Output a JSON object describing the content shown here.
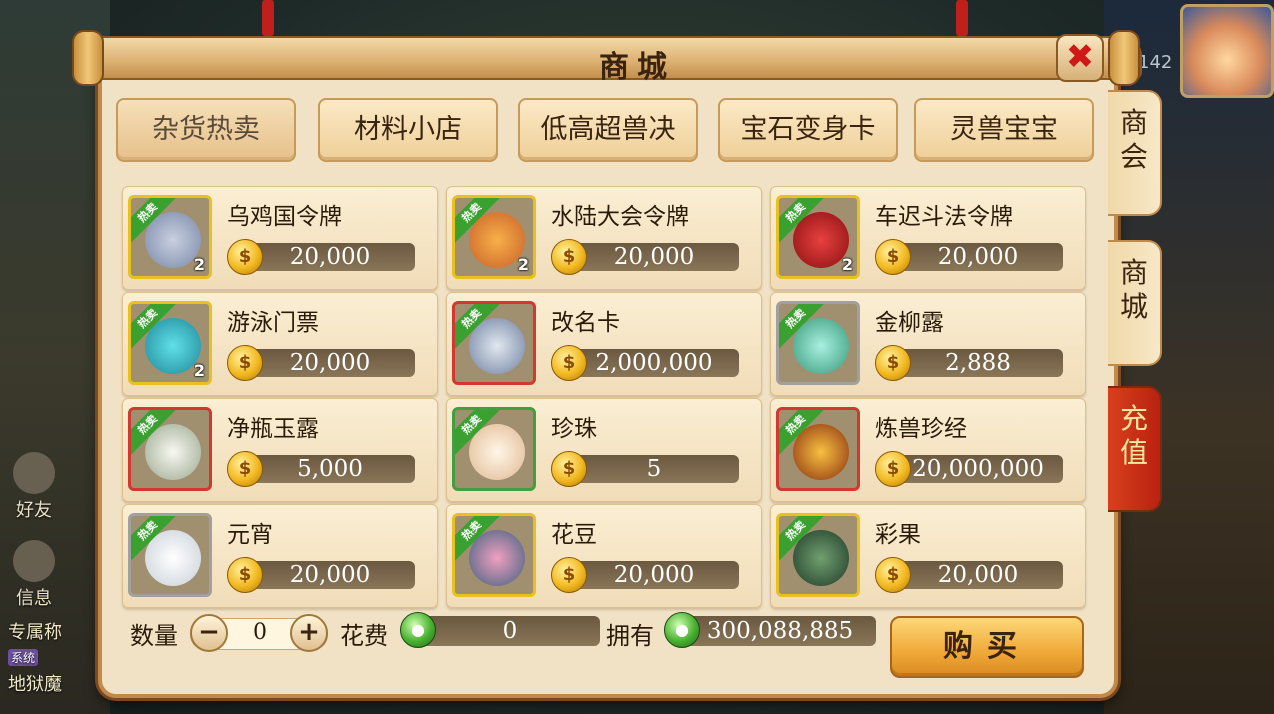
{
  "title": "商城",
  "close_label": "✖",
  "level_number": "142",
  "side": {
    "friends": "好友",
    "messages": "信息"
  },
  "chat": {
    "line1": "专属称",
    "line2_tag": "系统",
    "line3": "地狱魔"
  },
  "category_tabs": [
    "杂货热卖",
    "材料小店",
    "低高超兽决",
    "宝石变身卡",
    "灵兽宝宝"
  ],
  "side_tabs": [
    "商会",
    "商城",
    "充值"
  ],
  "hot_label": "热卖",
  "items": [
    {
      "name": "乌鸡国令牌",
      "price": "20,000",
      "qty": "2",
      "icon": "token-icon"
    },
    {
      "name": "水陆大会令牌",
      "price": "20,000",
      "qty": "2",
      "icon": "token-icon"
    },
    {
      "name": "车迟斗法令牌",
      "price": "20,000",
      "qty": "2",
      "icon": "token-icon"
    },
    {
      "name": "游泳门票",
      "price": "20,000",
      "qty": "2",
      "icon": "ticket-icon"
    },
    {
      "name": "改名卡",
      "price": "2,000,000",
      "qty": "",
      "icon": "scroll-icon"
    },
    {
      "name": "金柳露",
      "price": "2,888",
      "qty": "",
      "icon": "potion-icon"
    },
    {
      "name": "净瓶玉露",
      "price": "5,000",
      "qty": "",
      "icon": "vase-icon"
    },
    {
      "name": "珍珠",
      "price": "5",
      "qty": "",
      "icon": "pearl-icon"
    },
    {
      "name": "炼兽珍经",
      "price": "20,000,000",
      "qty": "",
      "icon": "book-icon"
    },
    {
      "name": "元宵",
      "price": "20,000",
      "qty": "",
      "icon": "dumpling-icon"
    },
    {
      "name": "花豆",
      "price": "20,000",
      "qty": "",
      "icon": "bean-icon"
    },
    {
      "name": "彩果",
      "price": "20,000",
      "qty": "",
      "icon": "fruit-icon"
    }
  ],
  "bottom": {
    "quantity_label": "数量",
    "quantity_value": "0",
    "minus": "−",
    "plus": "+",
    "cost_label": "花费",
    "cost_value": "0",
    "own_label": "拥有",
    "own_value": "300,088,885",
    "buy_label": "购买"
  },
  "colors": {
    "panel_bg": "#f1e2c6",
    "hot_badge": "#3aa030",
    "active_side_tab": "#c82a14"
  }
}
